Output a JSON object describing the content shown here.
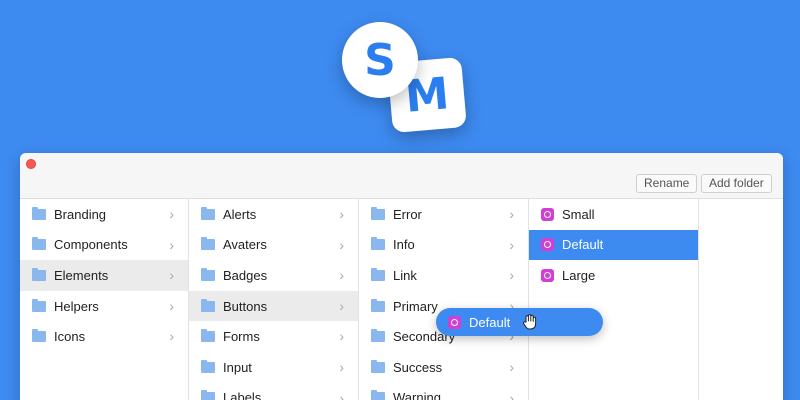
{
  "logo": {
    "letter_s": "S",
    "letter_m": "M"
  },
  "toolbar": {
    "rename_label": "Rename",
    "add_folder_label": "Add folder"
  },
  "columns": {
    "col1": [
      "Branding",
      "Components",
      "Elements",
      "Helpers",
      "Icons"
    ],
    "col2": [
      "Alerts",
      "Avaters",
      "Badges",
      "Buttons",
      "Forms",
      "Input",
      "Labels"
    ],
    "col3": [
      "Error",
      "Info",
      "Link",
      "Primary",
      "Secondary",
      "Success",
      "Warning"
    ],
    "col4": [
      "Small",
      "Default",
      "Large"
    ]
  },
  "chevron": "›",
  "drag": {
    "label": "Default"
  },
  "state": {
    "active_col1": "Elements",
    "active_col2": "Buttons",
    "selected_col4": "Default"
  },
  "colors": {
    "background": "#3d8af0",
    "accent": "#3d8af0",
    "symbol": "#d23ed6",
    "close": "#fb5650"
  },
  "icons": {
    "folder": "folder-icon",
    "symbol": "symbol-icon",
    "cursor": "grab-hand-icon"
  }
}
